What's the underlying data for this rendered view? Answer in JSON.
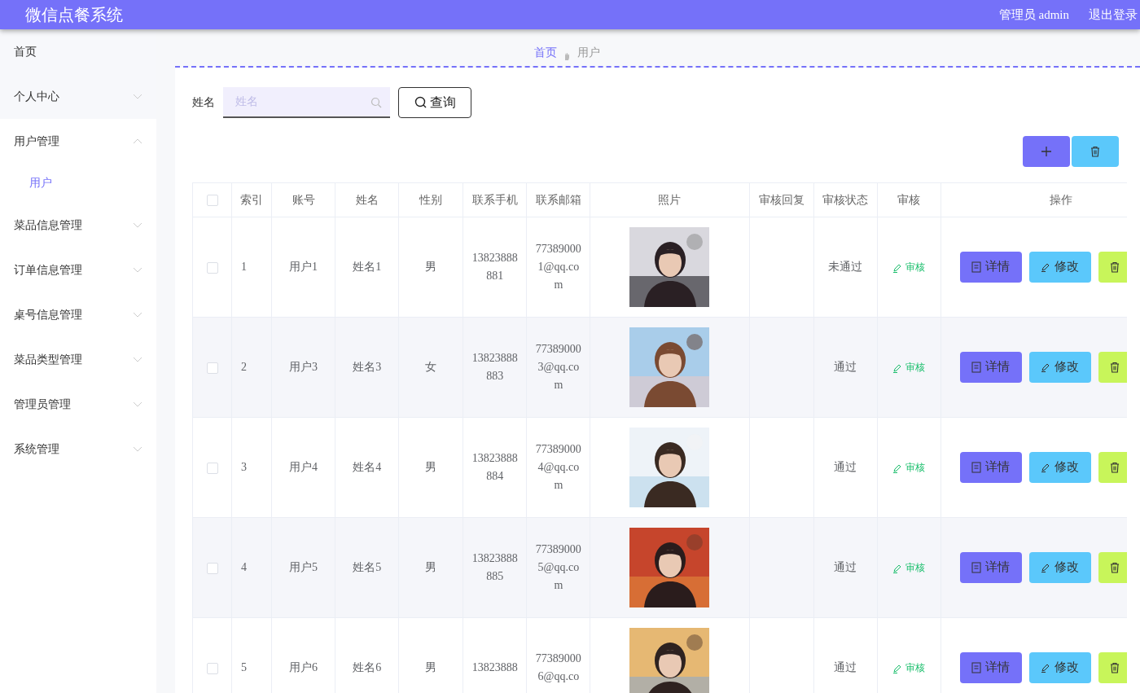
{
  "header": {
    "title": "微信点餐系统",
    "user": "管理员 admin",
    "logout": "退出登录"
  },
  "sidebar": {
    "items": [
      {
        "label": "首页"
      },
      {
        "label": "个人中心",
        "expanded": false
      },
      {
        "label": "用户管理",
        "expanded": true,
        "children": [
          {
            "label": "用户",
            "selected": true
          }
        ]
      },
      {
        "label": "菜品信息管理",
        "expanded": false
      },
      {
        "label": "订单信息管理",
        "expanded": false
      },
      {
        "label": "桌号信息管理",
        "expanded": false
      },
      {
        "label": "菜品类型管理",
        "expanded": false
      },
      {
        "label": "管理员管理",
        "expanded": false
      },
      {
        "label": "系统管理",
        "expanded": false
      }
    ]
  },
  "breadcrumb": [
    {
      "label": "首页",
      "selected": true
    },
    {
      "label": "用户",
      "selected": false
    }
  ],
  "search": {
    "label": "姓名",
    "placeholder": "姓名",
    "button": "查询"
  },
  "table": {
    "select_all_checked": false,
    "columns": [
      "索引",
      "账号",
      "姓名",
      "性别",
      "联系手机",
      "联系邮箱",
      "照片",
      "审核回复",
      "审核状态",
      "审核",
      "操作"
    ],
    "rows": [
      {
        "checked": false,
        "index": "1",
        "account": "用户1",
        "name": "姓名1",
        "gender": "男",
        "phone": "13823888881",
        "email": "773890001@qq.com",
        "status": "未通过",
        "audit": "审核",
        "actions": [
          "详情",
          "修改"
        ]
      },
      {
        "checked": false,
        "index": "2",
        "account": "用户3",
        "name": "姓名3",
        "gender": "女",
        "phone": "13823888883",
        "email": "773890003@qq.com",
        "status": "通过",
        "audit": "审核",
        "actions": [
          "详情",
          "修改"
        ]
      },
      {
        "checked": false,
        "index": "3",
        "account": "用户4",
        "name": "姓名4",
        "gender": "男",
        "phone": "13823888884",
        "email": "773890004@qq.com",
        "status": "通过",
        "audit": "审核",
        "actions": [
          "详情",
          "修改"
        ]
      },
      {
        "checked": false,
        "index": "4",
        "account": "用户5",
        "name": "姓名5",
        "gender": "男",
        "phone": "13823888885",
        "email": "773890005@qq.com",
        "status": "通过",
        "audit": "审核",
        "actions": [
          "详情",
          "修改"
        ]
      },
      {
        "checked": false,
        "index": "5",
        "account": "用户6",
        "name": "姓名6",
        "gender": "男",
        "phone": "13823888",
        "email": "773890006@qq.co",
        "status": "通过",
        "audit": "审核",
        "actions": [
          "详情",
          "修改"
        ]
      }
    ]
  }
}
